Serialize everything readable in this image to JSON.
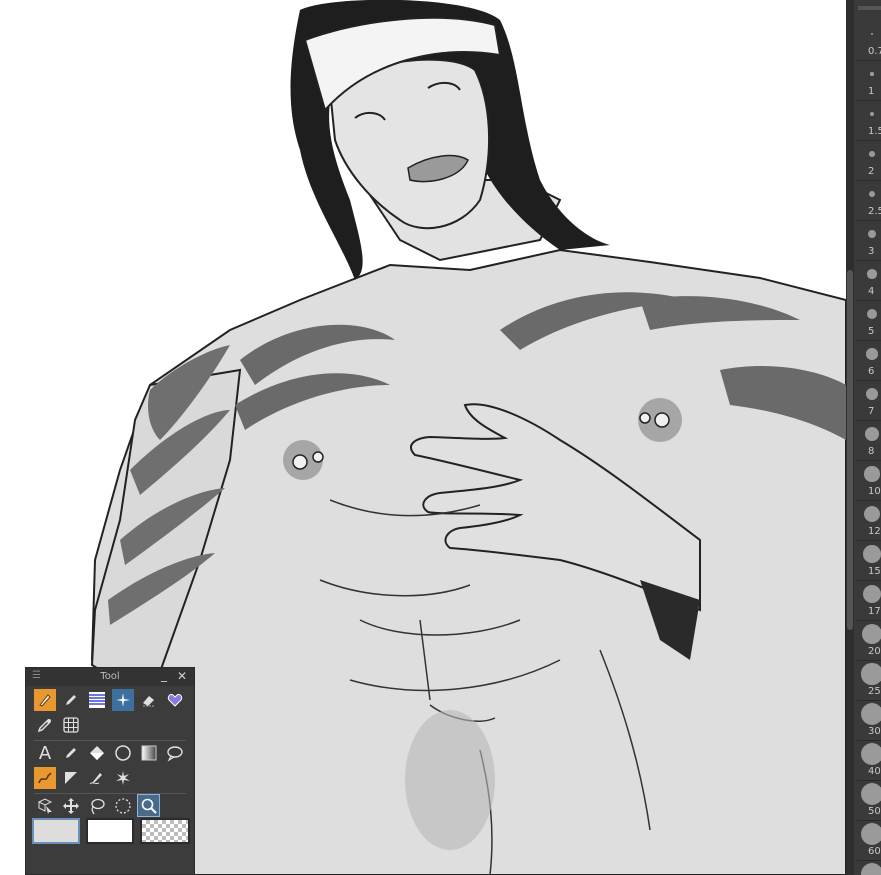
{
  "tool_palette": {
    "title": "Tool",
    "minimize_glyph": "_",
    "close_glyph": "✕",
    "grip_glyph": "☰",
    "text_tool_glyph": "A",
    "tools": [
      {
        "name": "pen-tool-icon",
        "active": true
      },
      {
        "name": "pencil-tool-icon",
        "active": false
      },
      {
        "name": "tone-tool-icon",
        "active": false
      },
      {
        "name": "sparkle-decoration-tool-icon",
        "active": false
      },
      {
        "name": "eraser-tool-icon",
        "active": false
      },
      {
        "name": "heart-material-icon",
        "active": false
      },
      {
        "name": "eyedropper-tool-icon",
        "active": false
      },
      {
        "name": "grid-ruler-tool-icon",
        "active": false
      },
      {
        "name": "text-tool-icon",
        "active": false
      },
      {
        "name": "fill-pen-tool-icon",
        "active": false
      },
      {
        "name": "fill-bucket-tool-icon",
        "active": false
      },
      {
        "name": "ellipse-tool-icon",
        "active": false
      },
      {
        "name": "gradient-tool-icon",
        "active": false
      },
      {
        "name": "balloon-tool-icon",
        "active": false
      },
      {
        "name": "vector-line-tool-icon",
        "active": true
      },
      {
        "name": "frame-border-tool-icon",
        "active": false
      },
      {
        "name": "correct-line-tool-icon",
        "active": false
      },
      {
        "name": "auto-select-tool-icon",
        "active": false
      },
      {
        "name": "object-select-tool-icon",
        "active": false
      },
      {
        "name": "move-tool-icon",
        "active": false
      },
      {
        "name": "lasso-tool-icon",
        "active": false
      },
      {
        "name": "selection-tool-icon",
        "active": false
      },
      {
        "name": "zoom-tool-icon",
        "active": true
      }
    ],
    "colors": {
      "main": "#dddddd",
      "sub": "#ffffff",
      "transparent": "checker"
    }
  },
  "brush_sizes": [
    "0.7",
    "1",
    "1.5",
    "2",
    "2.5",
    "3",
    "4",
    "5",
    "6",
    "7",
    "8",
    "10",
    "12",
    "15",
    "17",
    "20",
    "25",
    "30",
    "40",
    "50",
    "60",
    ""
  ],
  "theme": {
    "panel_bg": "#3c3c3c",
    "accent_orange": "#e8982e",
    "accent_blue": "#4a6a8a"
  }
}
